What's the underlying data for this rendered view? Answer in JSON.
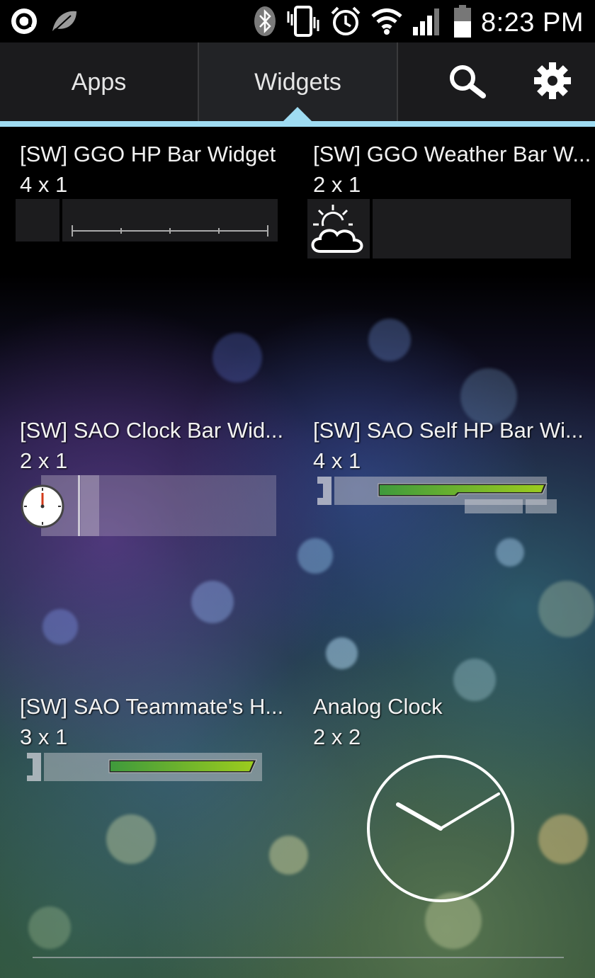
{
  "status_bar": {
    "time": "8:23 PM",
    "icons": [
      "app-circle-icon",
      "leaf-icon",
      "bluetooth-icon",
      "vibrate-icon",
      "alarm-icon",
      "wifi-icon",
      "signal-icon",
      "battery-icon"
    ]
  },
  "tabs": {
    "apps_label": "Apps",
    "widgets_label": "Widgets",
    "active": "Widgets",
    "accent_color": "#9fdcf2"
  },
  "actions": [
    "search-icon",
    "gear-icon"
  ],
  "widgets": [
    {
      "title": "[SW] GGO HP Bar Widget",
      "size": "4 x 1"
    },
    {
      "title": "[SW] GGO Weather Bar W...",
      "size": "2 x 1"
    },
    {
      "title": "[SW] SAO Clock Bar Wid...",
      "size": "2 x 1"
    },
    {
      "title": "[SW] SAO Self HP Bar Wi...",
      "size": "4 x 1"
    },
    {
      "title": "[SW] SAO Teammate's H...",
      "size": "3 x 1"
    },
    {
      "title": "Analog Clock",
      "size": "2 x 2"
    }
  ]
}
